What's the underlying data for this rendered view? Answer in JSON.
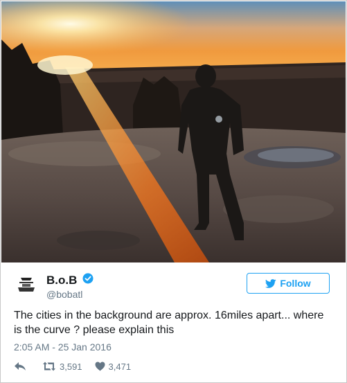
{
  "tweet": {
    "display_name": "B.o.B",
    "handle": "@bobatl",
    "follow_label": "Follow",
    "text": "The cities in the background are approx. 16miles apart... where is the curve ? please explain this",
    "timestamp": "2:05 AM - 25 Jan 2016",
    "retweet_count": "3,591",
    "like_count": "3,471",
    "verified": true
  },
  "icons": {
    "reply": "reply-icon",
    "retweet": "retweet-icon",
    "like": "heart-icon",
    "verified": "verified-badge-icon",
    "twitter": "twitter-bird-icon"
  },
  "colors": {
    "accent": "#1da1f2",
    "muted": "#657786",
    "text": "#14171a"
  }
}
